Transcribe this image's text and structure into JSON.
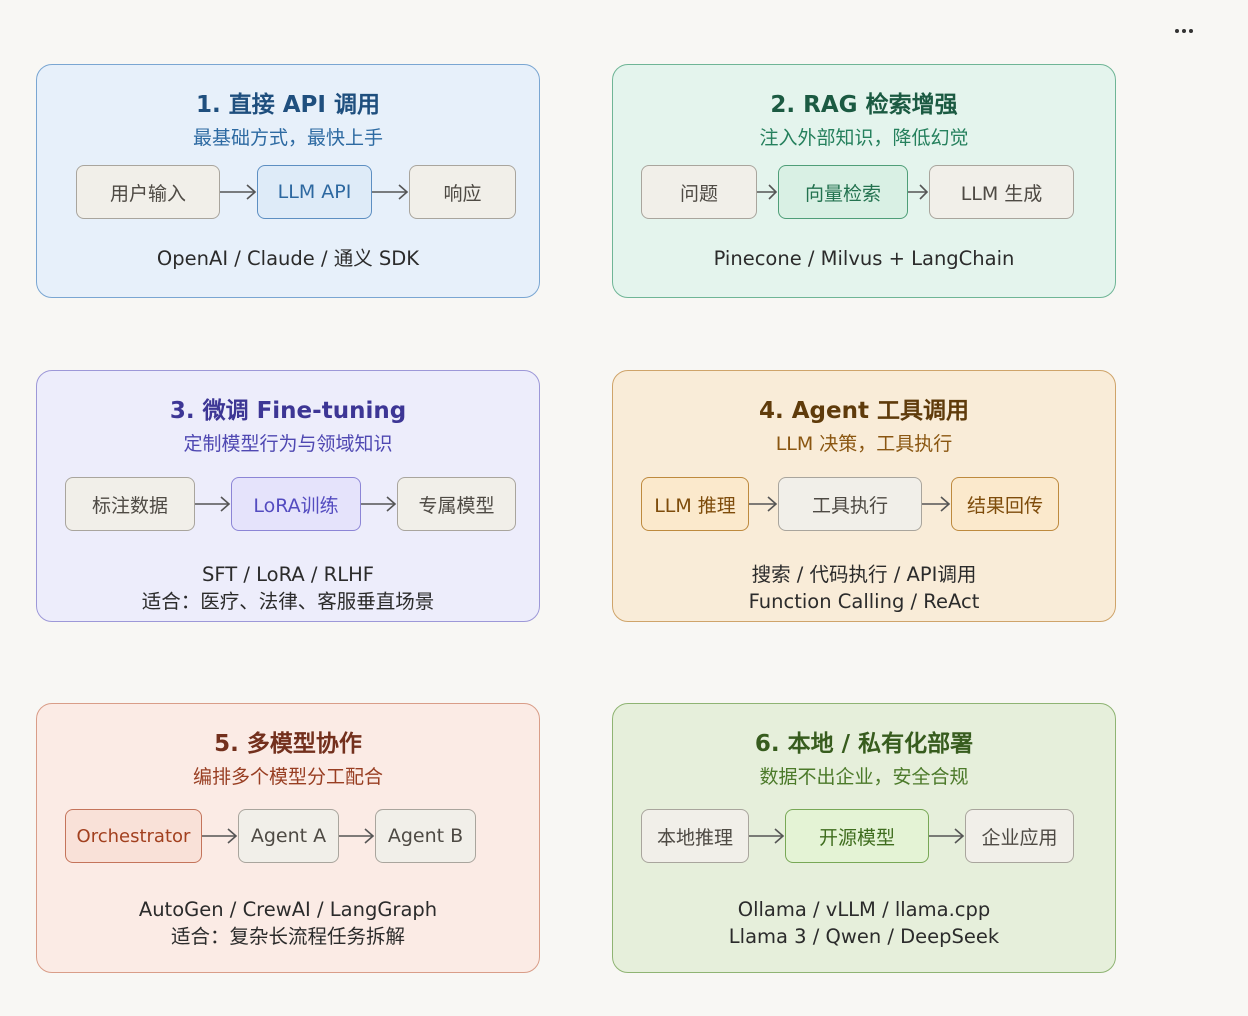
{
  "cards": [
    {
      "title": "1. 直接 API 调用",
      "subtitle": "最基础方式，最快上手",
      "nodes": [
        "用户输入",
        "LLM API",
        "响应"
      ],
      "footer": [
        "OpenAI / Claude / 通义 SDK"
      ]
    },
    {
      "title": "2. RAG 检索增强",
      "subtitle": "注入外部知识，降低幻觉",
      "nodes": [
        "问题",
        "向量检索",
        "LLM 生成"
      ],
      "footer": [
        "Pinecone / Milvus + LangChain"
      ]
    },
    {
      "title": "3. 微调 Fine-tuning",
      "subtitle": "定制模型行为与领域知识",
      "nodes": [
        "标注数据",
        "LoRA训练",
        "专属模型"
      ],
      "footer": [
        "SFT / LoRA / RLHF",
        "适合：医疗、法律、客服垂直场景"
      ]
    },
    {
      "title": "4. Agent 工具调用",
      "subtitle": "LLM 决策，工具执行",
      "nodes": [
        "LLM 推理",
        "工具执行",
        "结果回传"
      ],
      "footer": [
        "搜索 / 代码执行 / API调用",
        "Function Calling / ReAct"
      ]
    },
    {
      "title": "5. 多模型协作",
      "subtitle": "编排多个模型分工配合",
      "nodes": [
        "Orchestrator",
        "Agent A",
        "Agent B"
      ],
      "footer": [
        "AutoGen / CrewAI / LangGraph",
        "适合：复杂长流程任务拆解"
      ]
    },
    {
      "title": "6. 本地 / 私有化部署",
      "subtitle": "数据不出企业，安全合规",
      "nodes": [
        "本地推理",
        "开源模型",
        "企业应用"
      ],
      "footer": [
        "Ollama / vLLM / llama.cpp",
        "Llama 3 / Qwen / DeepSeek"
      ]
    }
  ],
  "icons": {
    "menu": "more-horizontal-icon",
    "connector": "arrow-right-icon"
  },
  "colors": {
    "background": "#f8f7f4",
    "arrow": "#555555"
  }
}
